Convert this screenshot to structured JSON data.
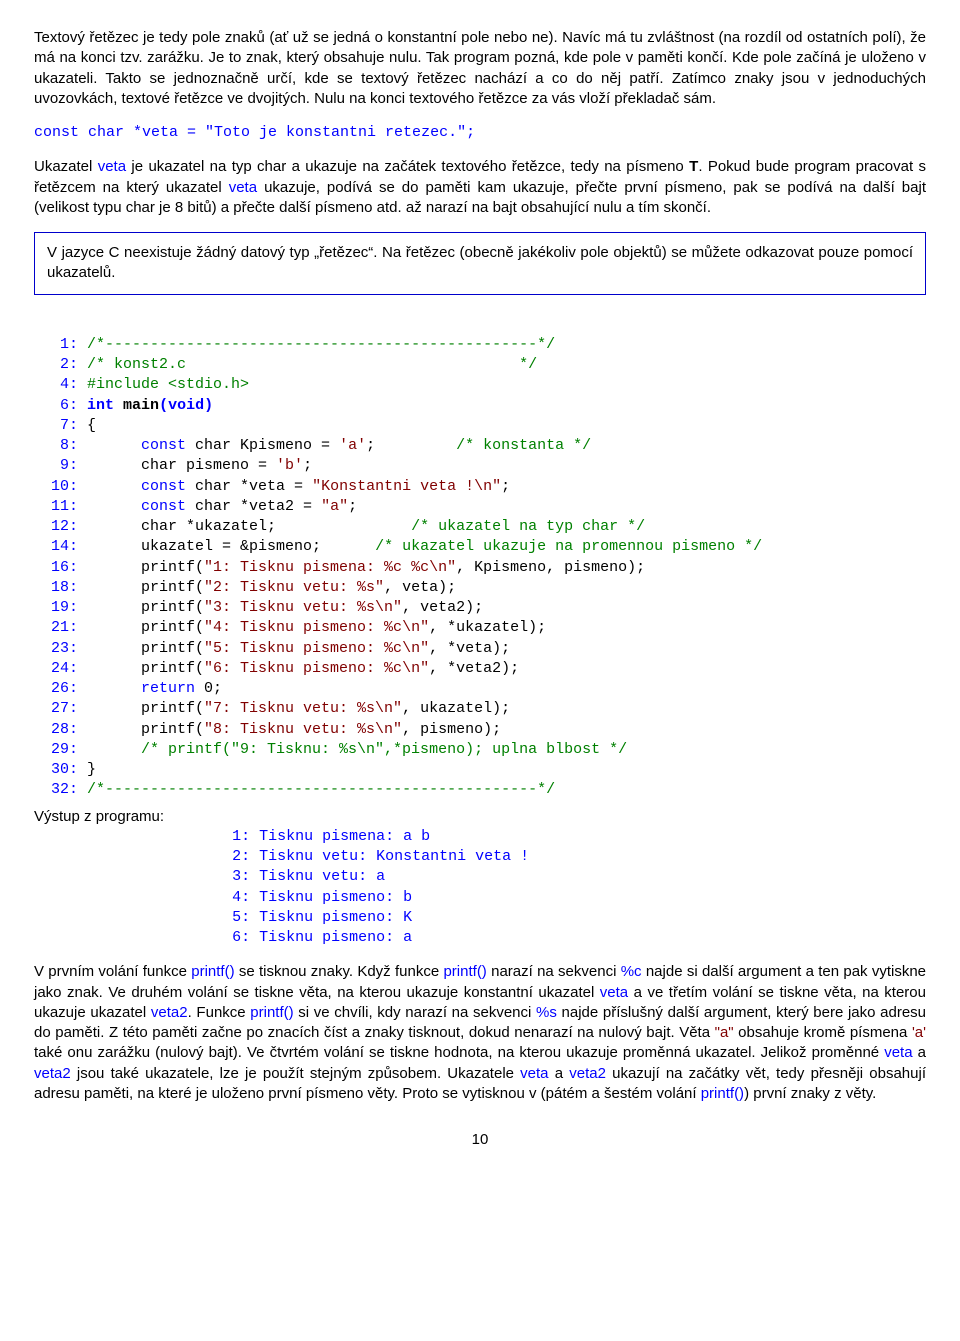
{
  "para1": "Textový řetězec je tedy pole znaků (ať už se jedná o konstantní pole nebo ne). Navíc má tu zvláštnost (na rozdíl od ostatních polí), že má na konci tzv. zarážku. Je to znak, který obsahuje nulu. Tak program pozná, kde pole v paměti končí. Kde pole začíná je uloženo v ukazateli. Takto se jednoznačně určí, kde se textový řetězec nachází a co do něj patří. Zatímco znaky jsou v jednoduchých uvozovkách, textové řetězce ve dvojitých. Nulu na konci textového řetězce za vás vloží překladač sám.",
  "codeLine": "const char *veta = \"Toto je konstantni retezec.\";",
  "para2_a": "Ukazatel ",
  "para2_b": " je ukazatel na typ char a ukazuje na začátek textového řetězce, tedy na písmeno ",
  "para2_c": ". Pokud bude program pracovat s řetězcem na který ukazatel ",
  "para2_d": " ukazuje, podívá se do paměti kam ukazuje, přečte první písmeno, pak se podívá na další bajt (velikost typu char je 8 bitů) a přečte další písmeno atd. až narazí na bajt obsahující nulu a tím skončí.",
  "infobox": "V jazyce C neexistuje žádný datový typ „řetězec“. Na řetězec (obecně jakékoliv pole objektů) se můžete odkazovat pouze pomocí ukazatelů.",
  "veta": "veta",
  "veta2": "veta2",
  "T": "T",
  "src": {
    "l1": "/*------------------------------------------------*/",
    "l2a": "/* konst2.c",
    "l2b": "*/",
    "l4": "#include <stdio.h>",
    "l6a": "int",
    "l6b": "main",
    "l6c": "(",
    "l6d": "void",
    "l6e": ")",
    "l7": "{",
    "l8a": "const",
    "l8b": " char Kpismeno = ",
    "l8c": "'a'",
    "l8d": ";",
    "l8e": "/* konstanta */",
    "l9a": "char pismeno = ",
    "l9b": "'b'",
    "l9c": ";",
    "l10a": "const",
    "l10b": " char *veta = ",
    "l10c": "\"Konstantni veta !\\n\"",
    "l10d": ";",
    "l11a": "const",
    "l11b": " char *veta2 = ",
    "l11c": "\"a\"",
    "l11d": ";",
    "l12a": "char *ukazatel;",
    "l12b": "/* ukazatel na typ char */",
    "l14a": "ukazatel = &pismeno;",
    "l14b": "/* ukazatel ukazuje na promennou pismeno */",
    "l16a": "printf(",
    "l16b": "\"1: Tisknu pismena: %c %c\\n\"",
    "l16c": ", Kpismeno, pismeno);",
    "l18a": "printf(",
    "l18b": "\"2: Tisknu vetu: %s\"",
    "l18c": ", veta);",
    "l19a": "printf(",
    "l19b": "\"3: Tisknu vetu: %s\\n\"",
    "l19c": ", veta2);",
    "l21a": "printf(",
    "l21b": "\"4: Tisknu pismeno: %c\\n\"",
    "l21c": ", *ukazatel);",
    "l23a": "printf(",
    "l23b": "\"5: Tisknu pismeno: %c\\n\"",
    "l23c": ", *veta);",
    "l24a": "printf(",
    "l24b": "\"6: Tisknu pismeno: %c\\n\"",
    "l24c": ", *veta2);",
    "l26a": "return",
    "l26b": " 0;",
    "l27a": "printf(",
    "l27b": "\"7: Tisknu vetu: %s\\n\"",
    "l27c": ", ukazatel);",
    "l28a": "printf(",
    "l28b": "\"8: Tisknu vetu: %s\\n\"",
    "l28c": ", pismeno);",
    "l29": "/* printf(\"9: Tisknu: %s\\n\",*pismeno); uplna blbost */",
    "l30": "}",
    "l32": "/*------------------------------------------------*/"
  },
  "outLabel": "Výstup z programu:",
  "out1": "1: Tisknu pismena: a b",
  "out2": "2: Tisknu vetu: Konstantni veta !",
  "out3": "3: Tisknu vetu: a",
  "out4": "4: Tisknu pismeno: b",
  "out5": "5: Tisknu pismeno: K",
  "out6": "6: Tisknu pismeno: a",
  "p3_a": "V prvním volání funkce ",
  "p3_b": " se tisknou znaky. Když funkce ",
  "p3_c": " narazí na sekvenci ",
  "p3_d": " najde si další argument a ten pak vytiskne jako znak. Ve druhém volání se tiskne věta, na kterou ukazuje konstantní ukazatel ",
  "p3_e": " a ve třetím volání se tiskne věta, na kterou ukazuje ukazatel ",
  "p3_f": ". Funkce ",
  "p3_g": " si ve chvíli, kdy narazí na sekvenci ",
  "p3_h": "  najde příslušný další argument, který bere jako adresu do paměti. Z této paměti začne po znacích číst a znaky tisknout, dokud nenarazí na nulový bajt. Věta ",
  "p3_i": " obsahuje kromě písmena ",
  "p3_j": " také onu zarážku (nulový bajt). Ve čtvrtém volání se tiskne hodnota, na kterou ukazuje proměnná ukazatel. Jelikož proměnné ",
  "p3_k": " a ",
  "p3_l": " jsou také ukazatele, lze je použít stejným způsobem. Ukazatele ",
  "p3_m": " ukazují na začátky vět, tedy přesněji obsahují adresu paměti, na které je uloženo první písmeno věty. Proto se vytisknou v (pátém a šestém volání ",
  "p3_n": ") první znaky z věty.",
  "printf": "printf()",
  "pc": "%c",
  "ps": "%s",
  "qa": "\"a\"",
  "ap": "'a'",
  "pagenum": "10"
}
